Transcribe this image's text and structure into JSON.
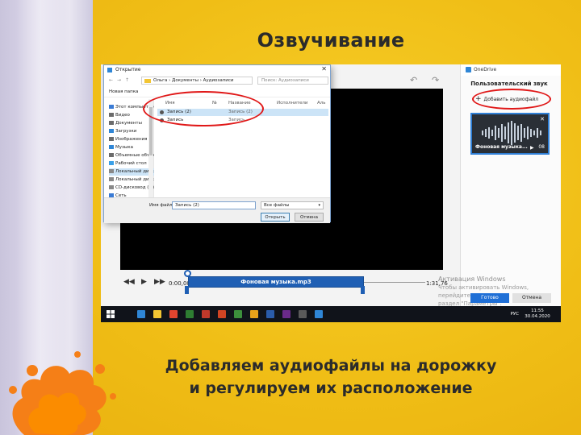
{
  "slide": {
    "title": "Озвучивание",
    "caption_line1": "Добавляем аудиофайлы на дорожку",
    "caption_line2": "и регулируем их расположение"
  },
  "dialog": {
    "title": "Открытие",
    "close_glyph": "✕",
    "address": "Ольга › Документы › Аудиозаписи",
    "search_placeholder": "Поиск: Аудиозаписи",
    "new_folder_label": "Новая папка",
    "nav_items": [
      {
        "label": "Этот компьютер",
        "color": "#3a7bd5"
      },
      {
        "label": "Видео",
        "color": "#6b6b6b"
      },
      {
        "label": "Документы",
        "color": "#6b6b6b"
      },
      {
        "label": "Загрузки",
        "color": "#2f86d6"
      },
      {
        "label": "Изображения",
        "color": "#6b6b6b"
      },
      {
        "label": "Музыка",
        "color": "#2f86d6"
      },
      {
        "label": "Объемные объекты",
        "color": "#6b6b6b"
      },
      {
        "label": "Рабочий стол",
        "color": "#3aa0e8"
      },
      {
        "label": "Локальный диск (C:)",
        "color": "#888888",
        "selected": true
      },
      {
        "label": "Локальный диск",
        "color": "#888888"
      },
      {
        "label": "CD-дисковод (F:)",
        "color": "#888888"
      },
      {
        "label": "Сеть",
        "color": "#3a7bd5"
      }
    ],
    "columns": [
      "Имя",
      "№",
      "Название",
      "Исполнители",
      "Аль"
    ],
    "files": [
      {
        "name": "Запись (2)",
        "title": "Запись (2)",
        "selected": true
      },
      {
        "name": "Запись",
        "title": "Запись",
        "selected": false
      }
    ],
    "filename_label": "Имя файла:",
    "filename_value": "Запись (2)",
    "filetype_value": "Все файлы",
    "open_button": "Открыть",
    "cancel_button": "Отмена"
  },
  "editor": {
    "current_time": "0:00,00",
    "total_time": "1:31,76",
    "track_label": "Фоновая музыка.mp3",
    "track_progress": 0.0
  },
  "panel": {
    "app_name": "OneDrive",
    "title": "Пользовательский звук",
    "add_audio_label": "Добавить аудиофайл",
    "add_audio_icon": "plus-icon",
    "clip_label": "Фоновая музыка...",
    "clip_duration": "08",
    "activation_title": "Активация Windows",
    "activation_line1": "Чтобы активировать Windows, перейдите в",
    "activation_line2": "раздел \"Параметры\".",
    "done_button": "Готово",
    "cancel_button": "Отмена"
  },
  "taskbar": {
    "language": "РУС",
    "time": "11:55",
    "date": "30.04.2020",
    "app_colors": [
      "#2f86d6",
      "#f2c533",
      "#e2452f",
      "#2e7d32",
      "#c0392b",
      "#d04423",
      "#3c8f3c",
      "#e8a21a",
      "#2a5caa",
      "#6a2a8a",
      "#5a5a5a",
      "#2f86d6"
    ]
  },
  "highlight_color": "#e01818"
}
